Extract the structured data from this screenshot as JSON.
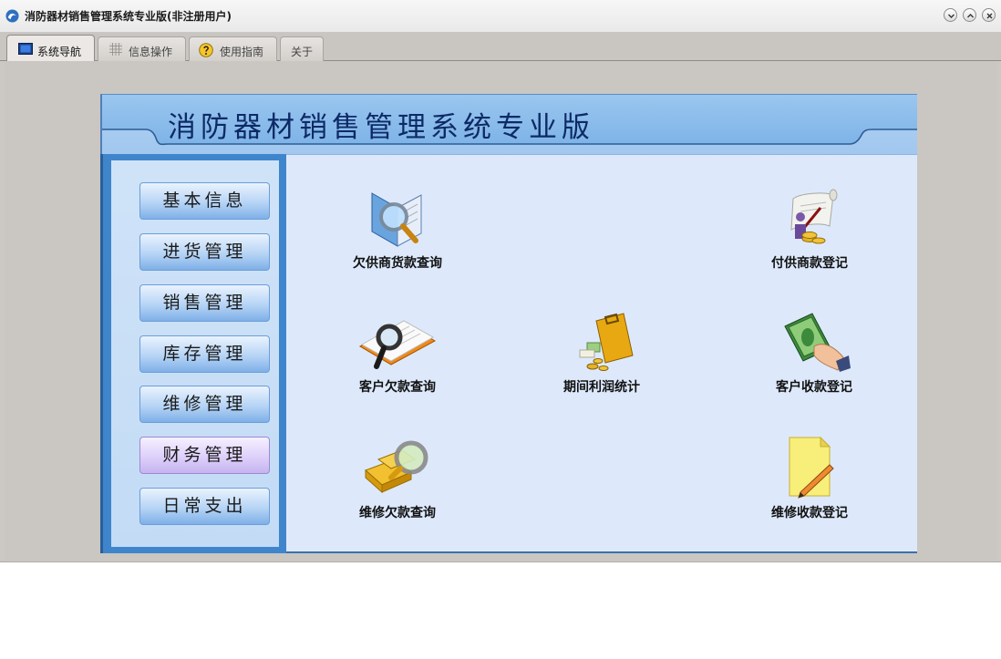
{
  "window": {
    "title": "消防器材销售管理系统专业版(非注册用户)",
    "controls": [
      "minimize-icon",
      "maximize-icon",
      "close-icon"
    ]
  },
  "tabs": [
    {
      "label": "系统导航",
      "icon": "monitor-icon",
      "active": true
    },
    {
      "label": "信息操作",
      "icon": "grid-icon",
      "active": false
    },
    {
      "label": "使用指南",
      "icon": "help-icon",
      "active": false
    },
    {
      "label": "关于",
      "icon": "",
      "active": false
    }
  ],
  "banner": {
    "title": "消防器材销售管理系统专业版"
  },
  "nav": [
    {
      "label": "基本信息"
    },
    {
      "label": "进货管理"
    },
    {
      "label": "销售管理"
    },
    {
      "label": "库存管理"
    },
    {
      "label": "维修管理"
    },
    {
      "label": "财务管理",
      "active": true
    },
    {
      "label": "日常支出"
    }
  ],
  "functions": [
    {
      "label": "欠供商货款查询",
      "icon": "book-magnifier-icon"
    },
    {
      "label": "付供商款登记",
      "icon": "scroll-coins-icon"
    },
    {
      "label": "客户欠款查询",
      "icon": "document-magnifier-icon"
    },
    {
      "label": "期间利润统计",
      "icon": "briefcase-coins-icon"
    },
    {
      "label": "客户收款登记",
      "icon": "hand-money-icon"
    },
    {
      "label": "维修欠款查询",
      "icon": "gold-magnifier-icon"
    },
    {
      "label": "维修收款登记",
      "icon": "note-pencil-icon"
    }
  ],
  "colors": {
    "banner": "#8bbcec",
    "panel": "#dde9fb",
    "sidebar": "#3f85cc",
    "active_nav": "#ddd0fa"
  }
}
